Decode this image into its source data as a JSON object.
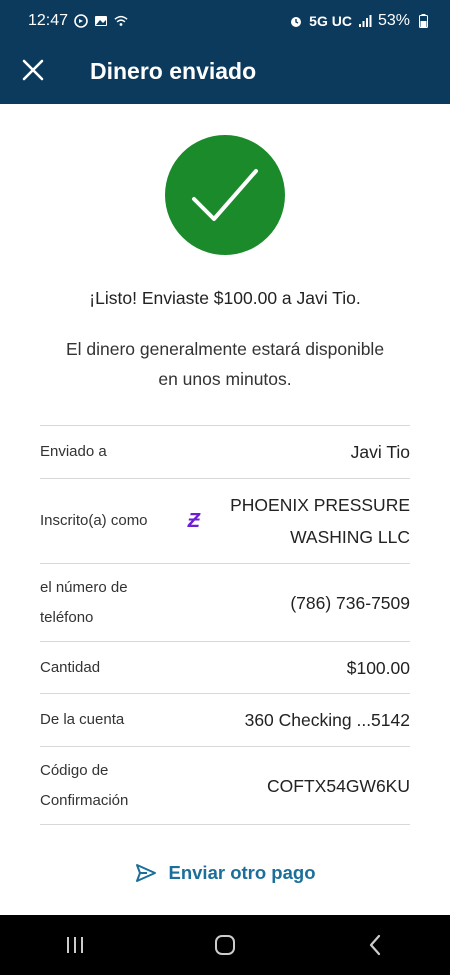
{
  "status_bar": {
    "time": "12:47",
    "network": "5G UC",
    "battery": "53%",
    "left_icons": [
      "whatsapp-icon",
      "image-icon",
      "wifi-icon"
    ],
    "right_icons": [
      "alarm-icon",
      "signal-icon",
      "battery-icon"
    ]
  },
  "header": {
    "title": "Dinero enviado",
    "close_icon": "close-icon"
  },
  "colors": {
    "header_bg": "#0b3a5c",
    "success_green": "#1a8a2b",
    "zelle_purple": "#6d1ed4",
    "link_blue": "#1b6f9a"
  },
  "messages": {
    "confirmation": "¡Listo! Enviaste $100.00 a Javi Tio.",
    "availability": "El dinero generalmente estará disponible en unos minutos."
  },
  "details": [
    {
      "label": "Enviado a",
      "value": "Javi Tio"
    },
    {
      "label": "Inscrito(a) como",
      "value": "PHOENIX PRESSURE WASHING LLC"
    },
    {
      "label": "el número de teléfono",
      "value": "(786) 736-7509"
    },
    {
      "label": "Cantidad",
      "value": "$100.00"
    },
    {
      "label": "De la cuenta",
      "value": "360 Checking ...5142"
    },
    {
      "label": "Código de Confirmación",
      "value": "COFTX54GW6KU"
    }
  ],
  "actions": {
    "send_again_label": "Enviar otro pago",
    "send_again_icon": "send-icon"
  },
  "nav_bar": {
    "buttons": [
      "recent-apps-icon",
      "home-icon",
      "back-icon"
    ]
  }
}
